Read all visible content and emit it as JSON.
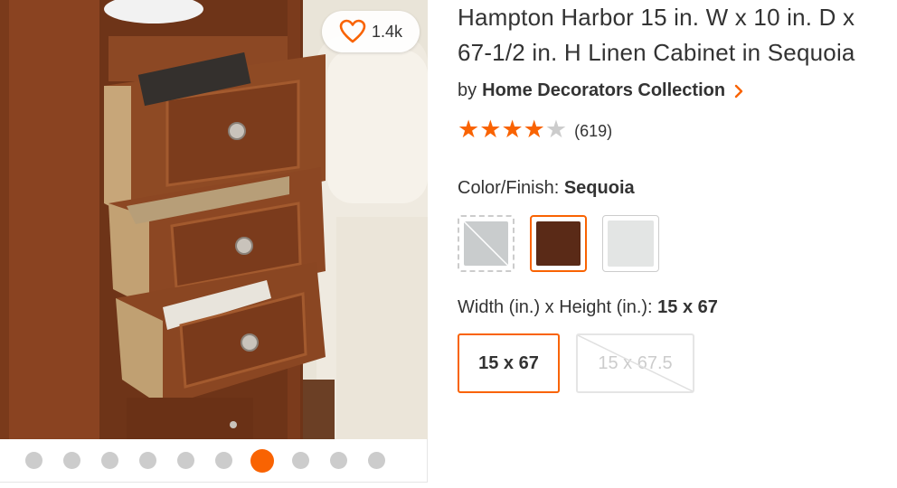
{
  "favorite": {
    "count": "1.4k",
    "icon": "heart-icon"
  },
  "gallery": {
    "dot_count": 10,
    "active_index": 6
  },
  "product": {
    "title": "Hampton Harbor 15 in. W x 10 in. D x 67-1/2 in. H Linen Cabinet in Sequoia",
    "brand_prefix": "by",
    "brand": "Home Decorators Collection",
    "rating": 4,
    "rating_max": 5,
    "review_count": "(619)"
  },
  "color": {
    "label": "Color/Finish:",
    "selected": "Sequoia",
    "swatches": [
      {
        "name": "grey",
        "hex": "#c9cccd",
        "state": "unavailable"
      },
      {
        "name": "Sequoia",
        "hex": "#5a2a17",
        "state": "selected"
      },
      {
        "name": "white",
        "hex": "#e3e5e4",
        "state": "available"
      }
    ]
  },
  "size": {
    "label": "Width (in.) x Height (in.):",
    "selected": "15 x 67",
    "options": [
      {
        "label": "15 x 67",
        "state": "selected"
      },
      {
        "label": "15 x 67.5",
        "state": "unavailable"
      }
    ]
  },
  "colors": {
    "accent": "#f96302",
    "text": "#333333",
    "muted": "#cccccc"
  }
}
